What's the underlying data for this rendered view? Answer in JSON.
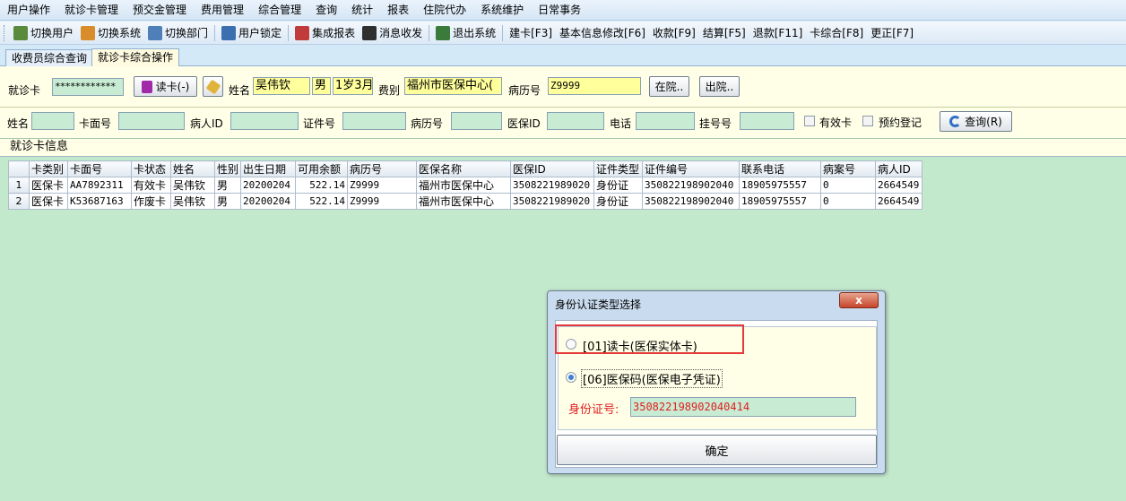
{
  "menu": [
    "用户操作",
    "就诊卡管理",
    "预交金管理",
    "费用管理",
    "综合管理",
    "查询",
    "统计",
    "报表",
    "住院代办",
    "系统维护",
    "日常事务"
  ],
  "toolbar": [
    {
      "label": "切换用户",
      "icon": "switch-user-icon",
      "color": "#5a8a3c"
    },
    {
      "label": "切换系统",
      "icon": "switch-system-icon",
      "color": "#d98c2a"
    },
    {
      "label": "切换部门",
      "icon": "switch-dept-icon",
      "color": "#4f7fb8"
    },
    {
      "label": "用户锁定",
      "icon": "user-lock-icon",
      "color": "#3b6fb0"
    },
    {
      "label": "集成报表",
      "icon": "report-icon",
      "color": "#c23b3b"
    },
    {
      "label": "消息收发",
      "icon": "message-icon",
      "color": "#2f2f2f"
    },
    {
      "label": "退出系统",
      "icon": "exit-icon",
      "color": "#3a7a3a"
    },
    {
      "label": "建卡[F3]",
      "icon": "",
      "color": ""
    },
    {
      "label": "基本信息修改[F6]",
      "icon": "",
      "color": ""
    },
    {
      "label": "收款[F9]",
      "icon": "",
      "color": ""
    },
    {
      "label": "结算[F5]",
      "icon": "",
      "color": ""
    },
    {
      "label": "退款[F11]",
      "icon": "",
      "color": ""
    },
    {
      "label": "卡综合[F8]",
      "icon": "",
      "color": ""
    },
    {
      "label": "更正[F7]",
      "icon": "",
      "color": ""
    }
  ],
  "tabs": [
    "收费员综合查询",
    "就诊卡综合操作"
  ],
  "top": {
    "card_label": "就诊卡",
    "card_value": "************",
    "read_card_btn": "读卡(-)",
    "name_label": "姓名",
    "name_value": "吴伟钦",
    "sex_value": "男",
    "age_value": "1岁3月",
    "fee_type_label": "费别",
    "fee_type_value": "福州市医保中心(",
    "record_label": "病历号",
    "record_value": "Z9999",
    "in_hospital_btn": "在院..",
    "discharge_btn": "出院.."
  },
  "search": {
    "name_label": "姓名",
    "card_no_label": "卡面号",
    "patient_id_label": "病人ID",
    "cert_no_label": "证件号",
    "record_label": "病历号",
    "insurance_id_label": "医保ID",
    "phone_label": "电话",
    "reg_no_label": "挂号号",
    "valid_card_label": "有效卡",
    "appointment_label": "预约登记",
    "query_btn": "查询(R)"
  },
  "grid": {
    "title": "就诊卡信息",
    "columns": [
      "",
      "卡类别",
      "卡面号",
      "卡状态",
      "姓名",
      "性别",
      "出生日期",
      "可用余额",
      "病历号",
      "医保名称",
      "医保ID",
      "证件类型",
      "证件编号",
      "联系电话",
      "病案号",
      "病人ID"
    ],
    "rows": [
      [
        "1",
        "医保卡",
        "AA7892311",
        "有效卡",
        "吴伟钦",
        "男",
        "20200204",
        "522.14",
        "Z9999",
        "福州市医保中心",
        "3508221989020",
        "身份证",
        "350822198902040",
        "18905975557",
        "0",
        "2664549"
      ],
      [
        "2",
        "医保卡",
        "K53687163",
        "作废卡",
        "吴伟钦",
        "男",
        "20200204",
        "522.14",
        "Z9999",
        "福州市医保中心",
        "3508221989020",
        "身份证",
        "350822198902040",
        "18905975557",
        "0",
        "2664549"
      ]
    ]
  },
  "dialog": {
    "title": "身份认证类型选择",
    "close": "x",
    "option1": "[01]读卡(医保实体卡)",
    "option2": "[06]医保码(医保电子凭证)",
    "id_label": "身份证号:",
    "id_value": "350822198902040414",
    "ok_btn": "确定"
  }
}
